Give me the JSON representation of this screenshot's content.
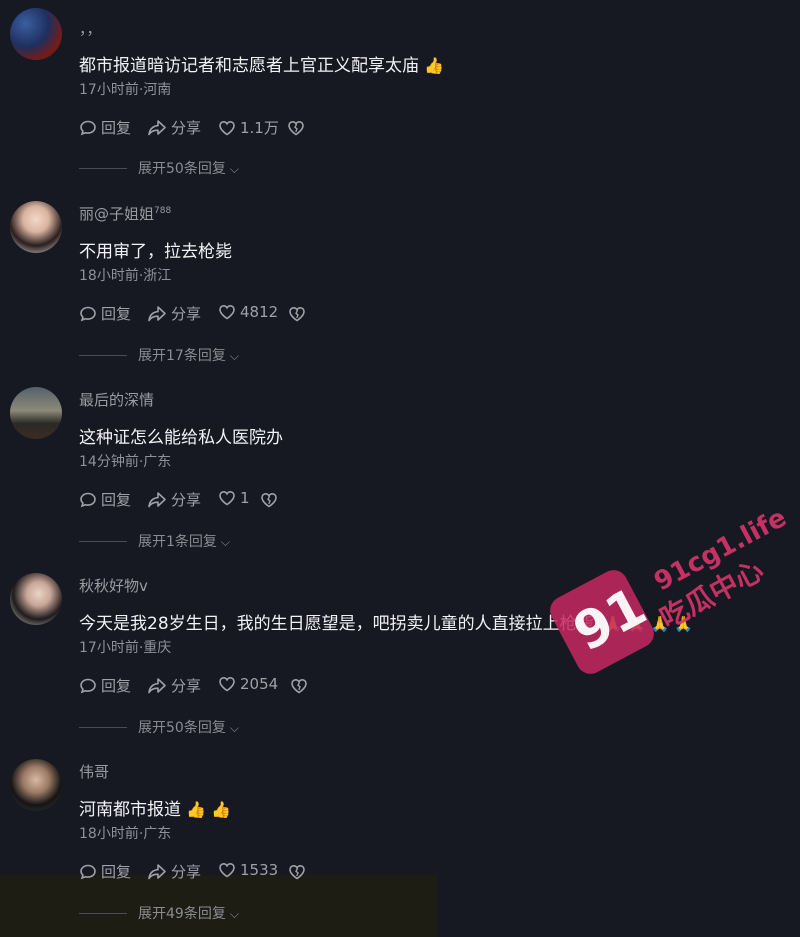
{
  "labels": {
    "reply": "回复",
    "share": "分享"
  },
  "comments": [
    {
      "author": "，，",
      "badge": "",
      "content": "都市报道暗访记者和志愿者上官正义配享太庙",
      "emoji": "👍",
      "meta": "17小时前·河南",
      "likes": "1.1万",
      "expand": "展开50条回复"
    },
    {
      "author": "丽@子姐姐",
      "badge": "788",
      "content": "不用审了，拉去枪毙",
      "emoji": "",
      "meta": "18小时前·浙江",
      "likes": "4812",
      "expand": "展开17条回复"
    },
    {
      "author": "最后的深情",
      "badge": "",
      "content": "这种证怎么能给私人医院办",
      "emoji": "",
      "meta": "14分钟前·广东",
      "likes": "1",
      "expand": "展开1条回复"
    },
    {
      "author": "秋秋好物v",
      "badge": "",
      "content": "今天是我28岁生日，我的生日愿望是，吧拐卖儿童的人直接拉上枪毙",
      "emoji": "🙏 🙏 🙏 🙏",
      "meta": "17小时前·重庆",
      "likes": "2054",
      "expand": "展开50条回复"
    },
    {
      "author": "伟哥",
      "badge": "",
      "content": "河南都市报道",
      "emoji": "👍 👍",
      "meta": "18小时前·广东",
      "likes": "1533",
      "expand": "展开49条回复"
    }
  ],
  "watermark": {
    "number": "91",
    "site": "91cg1.life",
    "name": "吃瓜中心"
  },
  "colors": {
    "background": "#161822",
    "watermark": "#c5285f",
    "emoji": "#f5b301"
  }
}
